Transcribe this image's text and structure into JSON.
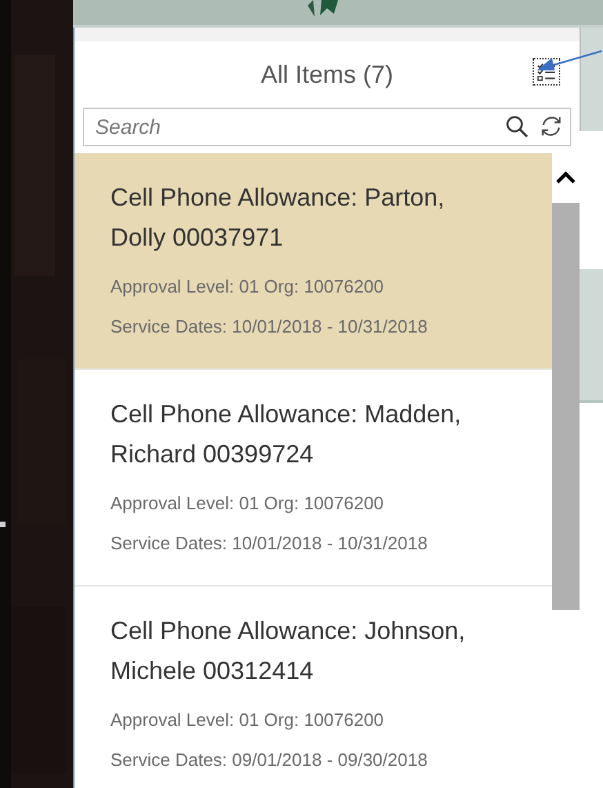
{
  "list_header": {
    "title": "All Items (7)"
  },
  "search": {
    "placeholder": "Search"
  },
  "items": [
    {
      "title": "Cell Phone Allowance: Parton, Dolly 00037971",
      "approval": "Approval Level: 01 Org: 10076200",
      "dates": "Service Dates: 10/01/2018 - 10/31/2018",
      "selected": true
    },
    {
      "title": "Cell Phone Allowance: Madden, Richard 00399724",
      "approval": "Approval Level: 01 Org: 10076200",
      "dates": "Service Dates: 10/01/2018 - 10/31/2018",
      "selected": false
    },
    {
      "title": "Cell Phone Allowance: Johnson, Michele 00312414",
      "approval": "Approval Level: 01 Org: 10076200",
      "dates": "Service Dates: 09/01/2018 - 09/30/2018",
      "selected": false
    }
  ]
}
